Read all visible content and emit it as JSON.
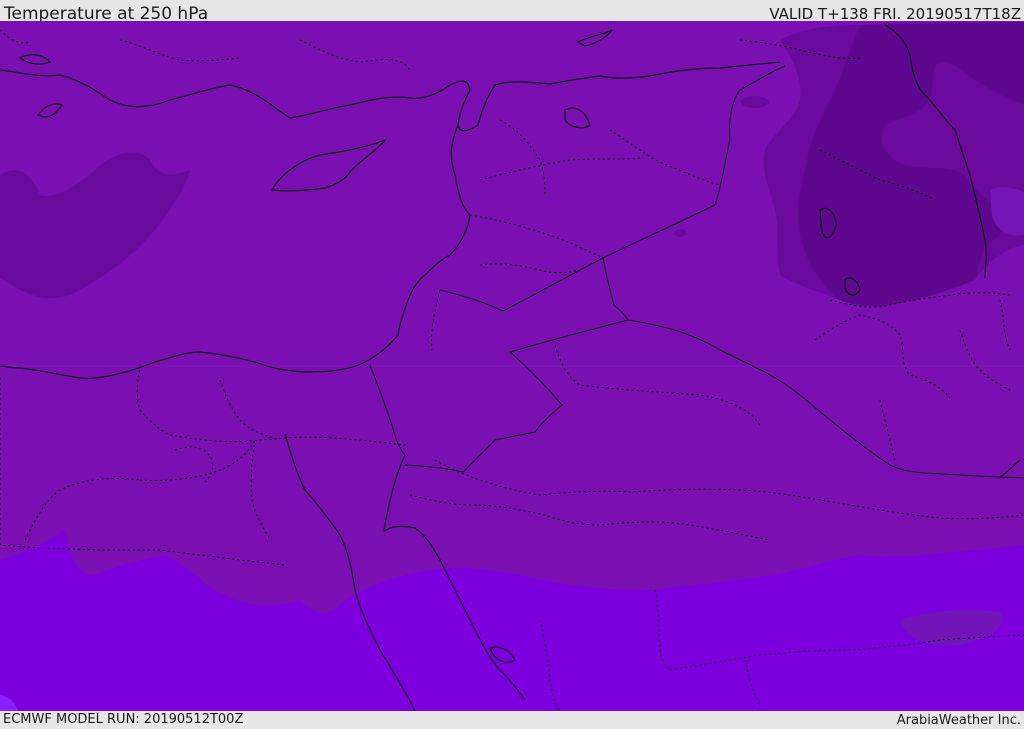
{
  "header": {
    "title": "Temperature at 250 hPa",
    "valid": "VALID T+138 FRI. 20190517T18Z"
  },
  "footer": {
    "model_run": "ECMWF MODEL RUN: 20190512T00Z",
    "credit": "ArabiaWeather Inc."
  },
  "colors": {
    "background": "#7a10b2",
    "warm_band": "#7c00dd",
    "cold_region": "#6a0a9c",
    "coldest_region": "#5e0890",
    "bright_spot": "#8a20ff",
    "coastline": "#111111",
    "border": "#111111"
  }
}
